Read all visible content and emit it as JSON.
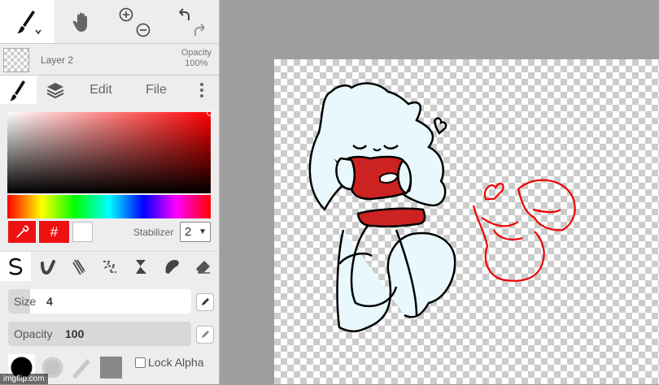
{
  "toolbar": {
    "brush_tool": "brush-icon",
    "hand_tool": "hand-icon",
    "zoom_in": "zoom-in-icon",
    "zoom_out": "zoom-out-icon",
    "undo": "undo-icon",
    "redo": "redo-icon"
  },
  "layer": {
    "name": "Layer 2",
    "opacity_label": "Opacity",
    "opacity_value": "100%"
  },
  "tabs": {
    "brush": "brush-icon",
    "layers": "layers-icon",
    "edit": "Edit",
    "file": "File",
    "more": "more-icon"
  },
  "color": {
    "current": "#ee1111",
    "secondary": "#ffffff",
    "hex_label": "#"
  },
  "stabilizer": {
    "label": "Stabilizer",
    "value": "2"
  },
  "brush_settings": {
    "size_label": "Size",
    "size_value": "4",
    "size_fraction": 0.12,
    "opacity_label": "Opacity",
    "opacity_value": "100",
    "opacity_fraction": 1.0,
    "lock_alpha_label": "Lock Alpha"
  },
  "watermark": "imgflip.com"
}
